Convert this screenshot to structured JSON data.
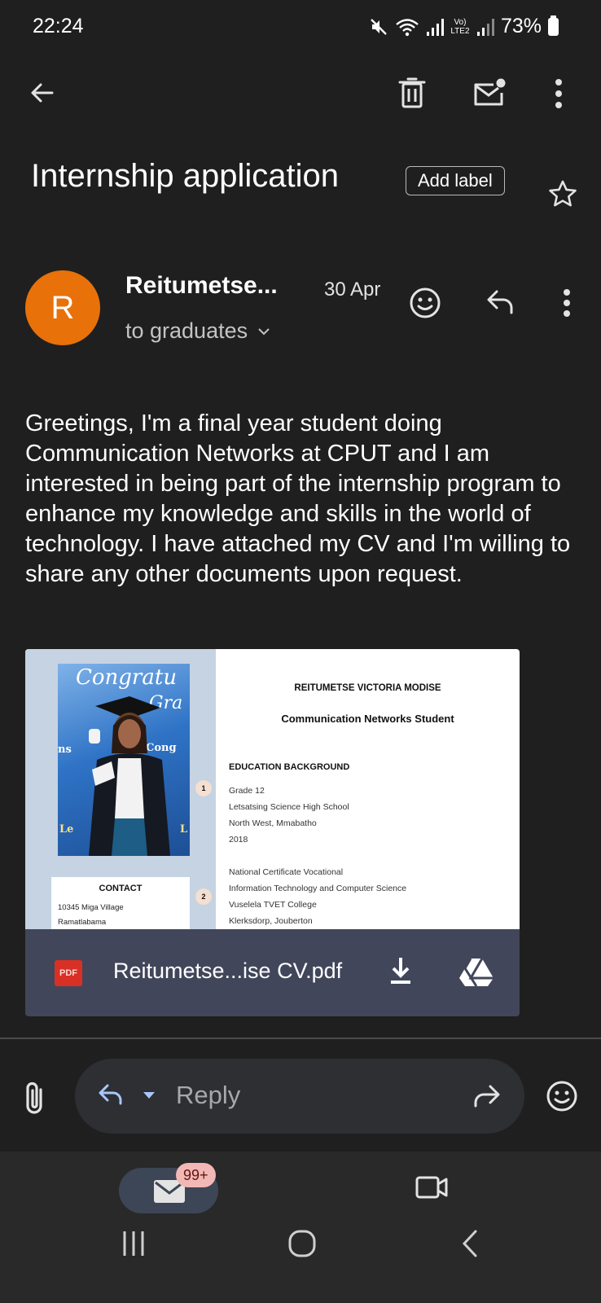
{
  "status_bar": {
    "time": "22:24",
    "network_label": "Vo) LTE2",
    "battery": "73%"
  },
  "toolbar": {
    "back_icon": "arrow-left-icon",
    "delete_icon": "trash-icon",
    "mark_unread_icon": "mail-dot-icon",
    "more_icon": "more-vert-icon"
  },
  "email": {
    "subject": "Internship application",
    "add_label": "Add label",
    "sender_initial": "R",
    "sender_name": "Reitumetse...",
    "date": "30 Apr",
    "recipients": "to graduates",
    "body": "Greetings, I'm a final year student doing Communication Networks at CPUT and I am interested in being part of the internship program to enhance my knowledge and skills in the world of technology. I have attached my CV and I'm willing to share any other documents upon request.",
    "avatar_color": "#e8710a"
  },
  "attachment": {
    "type_badge": "PDF",
    "filename": "Reitumetse...ise CV.pdf",
    "preview": {
      "photo_text_1": "Congratu",
      "photo_text_2": "Gra",
      "photo_text_3": "Cong",
      "photo_text_4": "ns",
      "photo_text_5": "Le",
      "photo_text_6": "L",
      "contact_title": "CONTACT",
      "contact_lines": [
        "10345 Miga Village",
        "Ramatlabama"
      ],
      "name": "REITUMETSE VICTORIA MODISE",
      "role": "Communication Networks Student",
      "section_heading": "EDUCATION BACKGROUND",
      "entries": [
        {
          "num": "1",
          "lines": [
            "Grade 12",
            "Letsatsing Science High School",
            "North West, Mmabatho",
            "2018"
          ]
        },
        {
          "num": "2",
          "lines": [
            "National Certificate Vocational",
            "Information Technology and Computer Science",
            "Vuselela TVET College",
            "Klerksdorp, Jouberton"
          ]
        }
      ]
    }
  },
  "reply_bar": {
    "reply_label": "Reply"
  },
  "bottom_nav": {
    "mail_badge": "99+"
  }
}
